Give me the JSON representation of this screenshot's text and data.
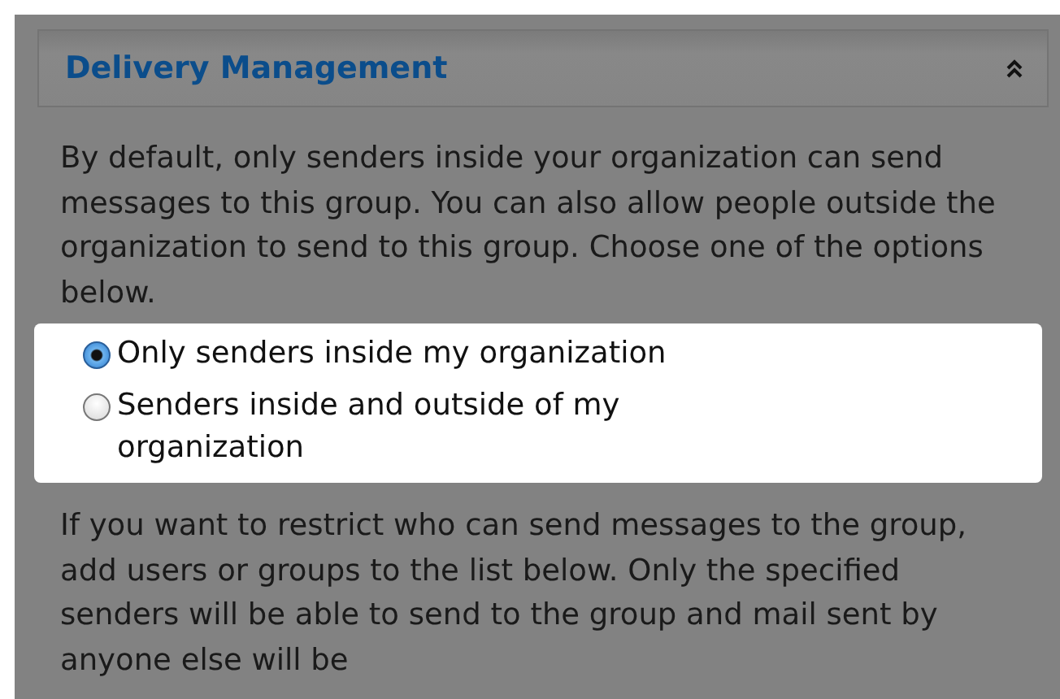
{
  "section": {
    "title": "Delivery Management",
    "expanded": true
  },
  "intro": "By default, only senders inside your organization can send messages to this group. You can also allow people outside the organization to send to this group. Choose one of the options below.",
  "options": [
    {
      "label": "Only senders inside my organization",
      "selected": true
    },
    {
      "label": "Senders inside and outside of my organization",
      "selected": false
    }
  ],
  "note": "If you want to restrict who can send messages to the group, add users or groups to the list below. Only the specified senders will be able to send to the group and mail sent by anyone else will be"
}
